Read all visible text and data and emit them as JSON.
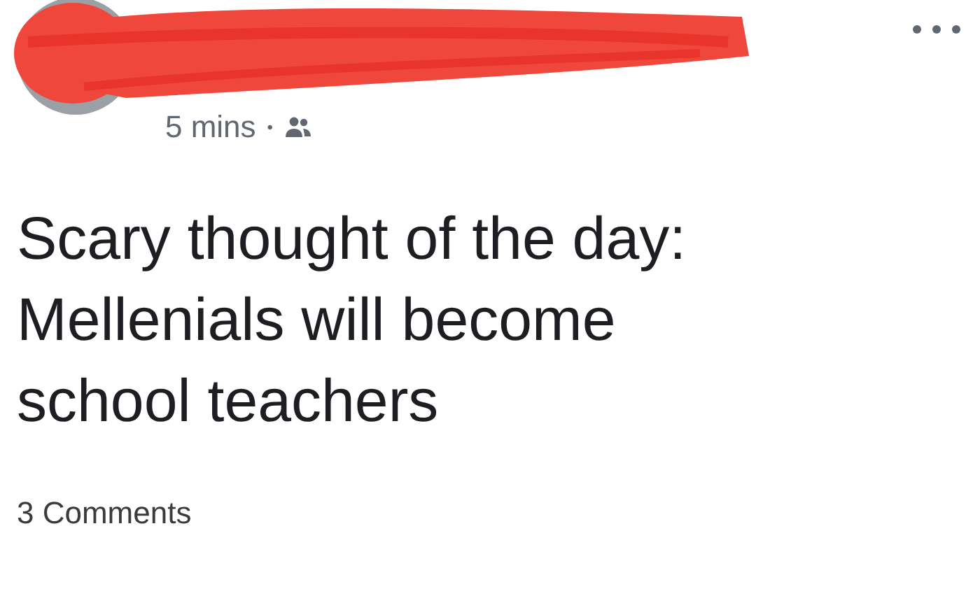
{
  "post": {
    "time": "5 mins",
    "separator": "•",
    "body": "Scary thought of the day:\nMellenials will become\nschool teachers",
    "comments": "3 Comments"
  }
}
